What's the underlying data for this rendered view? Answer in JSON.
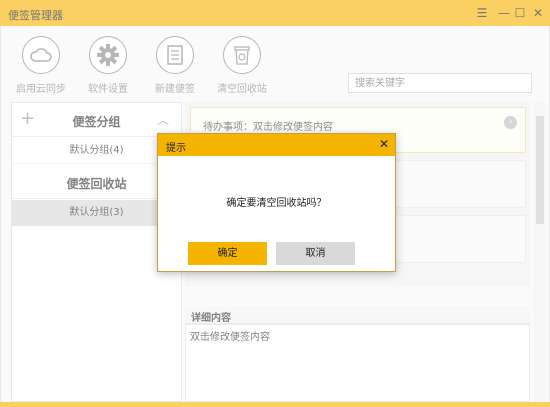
{
  "window": {
    "title": "便签管理器",
    "controls": {
      "menu": "☰",
      "minimize": "—",
      "maximize": "☐",
      "close": "✕"
    }
  },
  "toolbar": {
    "items": [
      {
        "label": "启用云同步",
        "icon": "cloud-icon"
      },
      {
        "label": "软件设置",
        "icon": "gear-icon"
      },
      {
        "label": "新建便签",
        "icon": "new-note-icon"
      },
      {
        "label": "清空回收站",
        "icon": "recycle-bin-icon"
      }
    ],
    "search_placeholder": "搜索关键字"
  },
  "sidebar": {
    "groups_title": "便签分组",
    "groups": [
      {
        "label": "默认分组(4)"
      }
    ],
    "recycle_title": "便签回收站",
    "recycle_items": [
      {
        "label": "默认分组(3)"
      }
    ],
    "add_symbol": "+",
    "collapse_symbol": "︿"
  },
  "notes": [
    {
      "text": "待办事项：双击修改便签内容",
      "arrow": "›"
    },
    {
      "text": ""
    },
    {
      "text": ""
    }
  ],
  "detail": {
    "title": "详细内容",
    "content": "双击修改便签内容"
  },
  "dialog": {
    "title": "提示",
    "close": "✕",
    "message": "确定要清空回收站吗？",
    "ok_label": "确定",
    "cancel_label": "取消"
  },
  "colors": {
    "accent": "#f5b400",
    "selected": "#d9d9d9"
  }
}
